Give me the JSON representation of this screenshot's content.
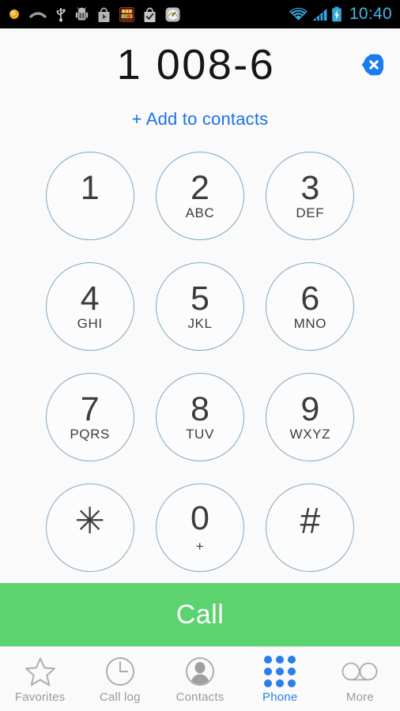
{
  "status_bar": {
    "time": "10:40",
    "time_color": "#47b6e0",
    "background": "#000000",
    "left_icons": [
      {
        "name": "sun-brightness-icon",
        "label": "sun"
      },
      {
        "name": "arc-gesture-icon",
        "label": "arc"
      },
      {
        "name": "usb-icon",
        "label": "USB"
      },
      {
        "name": "android-debug-icon",
        "label": "Android"
      },
      {
        "name": "play-store-icon",
        "label": "Play Store"
      },
      {
        "name": "slots-game-icon",
        "label": "Game"
      },
      {
        "name": "check-bag-icon",
        "label": "Installed"
      },
      {
        "name": "speedometer-icon",
        "label": "Gauge"
      }
    ],
    "right_icons": [
      {
        "name": "wifi-icon",
        "label": "Wi-Fi"
      },
      {
        "name": "cellular-signal-icon",
        "label": "Signal"
      },
      {
        "name": "battery-charging-icon",
        "label": "Battery charging"
      }
    ]
  },
  "display": {
    "number": "1 008-6",
    "delete_button_label": "Delete",
    "delete_button_color": "#1a7cf0"
  },
  "add_to_contacts": {
    "label": "+ Add to contacts",
    "color": "#1a73e8"
  },
  "keypad": {
    "keys": [
      {
        "digit": "1",
        "letters": ""
      },
      {
        "digit": "2",
        "letters": "ABC"
      },
      {
        "digit": "3",
        "letters": "DEF"
      },
      {
        "digit": "4",
        "letters": "GHI"
      },
      {
        "digit": "5",
        "letters": "JKL"
      },
      {
        "digit": "6",
        "letters": "MNO"
      },
      {
        "digit": "7",
        "letters": "PQRS"
      },
      {
        "digit": "8",
        "letters": "TUV"
      },
      {
        "digit": "9",
        "letters": "WXYZ"
      },
      {
        "digit": "✳",
        "letters": ""
      },
      {
        "digit": "0",
        "letters": "+"
      },
      {
        "digit": "#",
        "letters": ""
      }
    ],
    "border_color": "#7fa8c4"
  },
  "call_button": {
    "label": "Call",
    "background": "#5cd36e",
    "text_color": "#ffffff"
  },
  "bottom_nav": {
    "active_color": "#2b7de9",
    "inactive_color": "#9a9a9a",
    "items": [
      {
        "label": "Favorites",
        "icon": "star-icon",
        "active": false
      },
      {
        "label": "Call log",
        "icon": "clock-icon",
        "active": false
      },
      {
        "label": "Contacts",
        "icon": "person-circle-icon",
        "active": false
      },
      {
        "label": "Phone",
        "icon": "dialpad-grid-icon",
        "active": true
      },
      {
        "label": "More",
        "icon": "voicemail-icon",
        "active": false
      }
    ]
  }
}
